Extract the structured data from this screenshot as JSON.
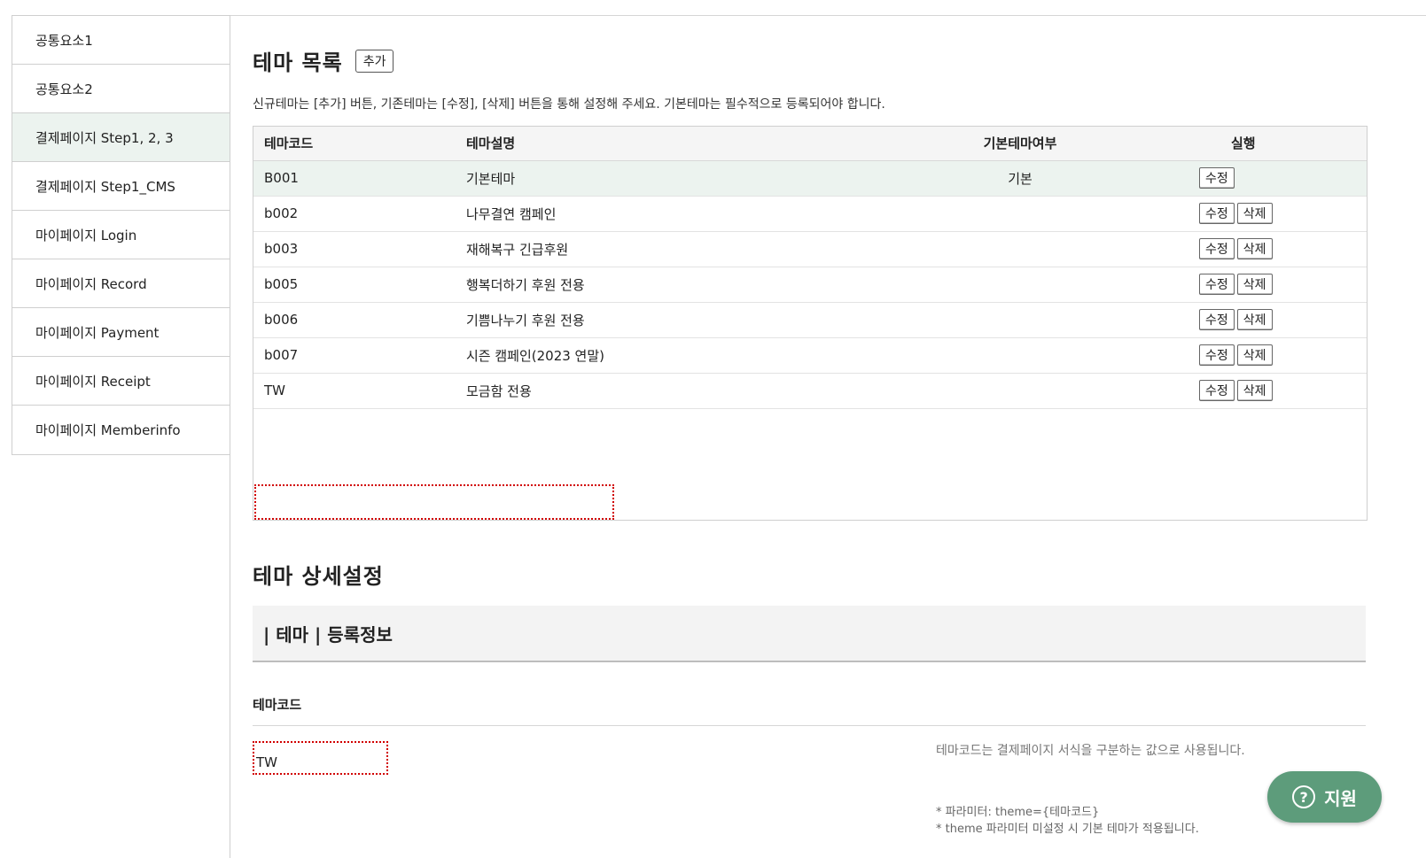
{
  "sidebar": {
    "items": [
      {
        "label": "공통요소1"
      },
      {
        "label": "공통요소2"
      },
      {
        "label": "결제페이지 Step1, 2, 3"
      },
      {
        "label": "결제페이지 Step1_CMS"
      },
      {
        "label": "마이페이지 Login"
      },
      {
        "label": "마이페이지 Record"
      },
      {
        "label": "마이페이지 Payment"
      },
      {
        "label": "마이페이지 Receipt"
      },
      {
        "label": "마이페이지 Memberinfo"
      }
    ],
    "active_index": 2
  },
  "theme_list": {
    "title": "테마 목록",
    "add_label": "추가",
    "description": "신규테마는 [추가] 버튼, 기존테마는 [수정], [삭제] 버튼을 통해 설정해 주세요. 기본테마는 필수적으로 등록되어야 합니다.",
    "headers": [
      "테마코드",
      "테마설명",
      "기본테마여부",
      "실행"
    ],
    "edit_label": "수정",
    "delete_label": "삭제",
    "rows": [
      {
        "code": "B001",
        "desc": "기본테마",
        "default": "기본"
      },
      {
        "code": "b002",
        "desc": "나무결연 캠페인",
        "default": ""
      },
      {
        "code": "b003",
        "desc": "재해복구 긴급후원",
        "default": ""
      },
      {
        "code": "b005",
        "desc": "행복더하기 후원 전용",
        "default": ""
      },
      {
        "code": "b006",
        "desc": "기쁨나누기 후원 전용",
        "default": ""
      },
      {
        "code": "b007",
        "desc": "시즌 캠페인(2023 연말)",
        "default": ""
      },
      {
        "code": "TW",
        "desc": "모금함 전용",
        "default": ""
      }
    ]
  },
  "theme_detail": {
    "title": "테마 상세설정",
    "panel_title": "| 테마 | 등록정보",
    "field_label": "테마코드",
    "field_value": "TW",
    "hint": "테마코드는 결제페이지 서식을 구분하는 값으로 사용됩니다.",
    "note1": "* 파라미터: theme={테마코드}",
    "note2": "* theme 파라미터 미설정 시 기본 테마가 적용됩니다."
  },
  "support": {
    "label": "지원",
    "icon": "?"
  },
  "colors": {
    "accent": "#5d9c7b",
    "highlight_row": "#ecf3ef",
    "dotted_border": "#d10000"
  }
}
